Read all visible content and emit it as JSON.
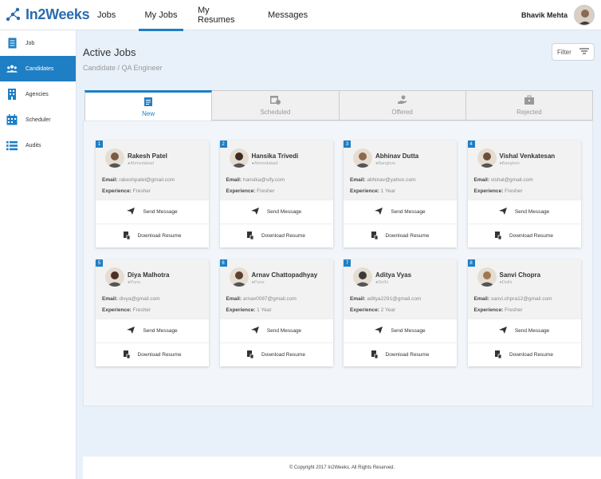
{
  "app": {
    "logo_text": "In2Weeks"
  },
  "nav": {
    "items": [
      {
        "label": "Jobs",
        "active": false
      },
      {
        "label": "My Jobs",
        "active": true
      },
      {
        "label": "My Resumes",
        "active": false
      },
      {
        "label": "Messages",
        "active": false
      }
    ]
  },
  "user": {
    "name": "Bhavik Mehta"
  },
  "sidebar": {
    "items": [
      {
        "label": "Job",
        "icon": "document-icon",
        "active": false
      },
      {
        "label": "Candidates",
        "icon": "people-icon",
        "active": true
      },
      {
        "label": "Agencies",
        "icon": "building-icon",
        "active": false
      },
      {
        "label": "Scheduler",
        "icon": "calendar-icon",
        "active": false
      },
      {
        "label": "Audits",
        "icon": "list-icon",
        "active": false
      }
    ]
  },
  "page": {
    "title": "Active Jobs",
    "subtitle": "Candidate / QA Engineer",
    "filter_label": "Filter"
  },
  "tabs": [
    {
      "label": "New",
      "icon": "clipboard-icon",
      "active": true
    },
    {
      "label": "Scheduled",
      "icon": "calendar-clock-icon",
      "active": false
    },
    {
      "label": "Offered",
      "icon": "hand-coin-icon",
      "active": false
    },
    {
      "label": "Rejected",
      "icon": "briefcase-icon",
      "active": false
    }
  ],
  "cards": [
    {
      "num": "1",
      "name": "Rakesh Patel",
      "location": "Ahmedabad",
      "email": "rakeshpatel@gmail.com",
      "experience": "Fresher"
    },
    {
      "num": "2",
      "name": "Hansika Trivedi",
      "location": "Ahmedabad",
      "email": "hansika@sify.com",
      "experience": "Fresher"
    },
    {
      "num": "3",
      "name": "Abhinav Dutta",
      "location": "Banglore",
      "email": "abhinav@yahoo.com",
      "experience": "1 Year"
    },
    {
      "num": "4",
      "name": "Vishal Venkatesan",
      "location": "Banglore",
      "email": "vishal@gmail.com",
      "experience": "Fresher"
    },
    {
      "num": "5",
      "name": "Diya Malhotra",
      "location": "Pune",
      "email": "divya@gmail.com",
      "experience": "Fresher"
    },
    {
      "num": "6",
      "name": "Arnav Chattopadhyay",
      "location": "Pune",
      "email": "arnav0087@gmail.com",
      "experience": "1 Year"
    },
    {
      "num": "7",
      "name": "Aditya Vyas",
      "location": "Delhi",
      "email": "aditya2291@gmail.com",
      "experience": "2 Year"
    },
    {
      "num": "8",
      "name": "Sanvi Chopra",
      "location": "Delhi",
      "email": "sanvi.chpra12@gmail.com",
      "experience": "Fresher"
    }
  ],
  "card_labels": {
    "email": "Email:",
    "experience": "Experience:",
    "send_message": "Send Message",
    "download_resume": "Download Resume"
  },
  "footer": {
    "text": "© Copyright 2017 In2Weeks. All Rights Reserved."
  },
  "colors": {
    "accent": "#1f7fc4",
    "background": "#e8f1fa"
  }
}
